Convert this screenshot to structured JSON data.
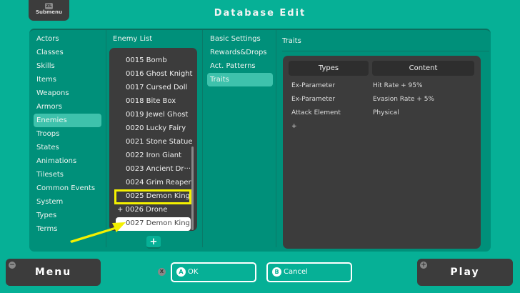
{
  "header": {
    "submenu_icon": "ZL",
    "submenu_label": "Submenu",
    "title": "Database Edit"
  },
  "categories": [
    "Actors",
    "Classes",
    "Skills",
    "Items",
    "Weapons",
    "Armors",
    "Enemies",
    "Troops",
    "States",
    "Animations",
    "Tilesets",
    "Common Events",
    "System",
    "Types",
    "Terms"
  ],
  "selected_category": "Enemies",
  "enemy_list": {
    "heading": "Enemy List",
    "items": [
      "0015 Bomb",
      "0016 Ghost Knight",
      "0017 Cursed Doll",
      "0018 Bite Box",
      "0019 Jewel Ghost",
      "0020 Lucky Fairy",
      "0021 Stone Statue",
      "0022 Iron Giant",
      "0023 Ancient Dr···",
      "0024 Grim Reaper",
      "0025 Demon King",
      "+ 0026 Drone",
      "0027 Demon King"
    ],
    "add_label": "+"
  },
  "tabs": [
    "Basic Settings",
    "Rewards&Drops",
    "Act. Patterns",
    "Traits"
  ],
  "active_tab": "Traits",
  "traits": {
    "heading": "Traits",
    "col_types": "Types",
    "col_content": "Content",
    "rows": [
      {
        "type": "Ex-Parameter",
        "content": "Hit Rate + 95%"
      },
      {
        "type": "Ex-Parameter",
        "content": "Evasion Rate + 5%"
      },
      {
        "type": "Attack Element",
        "content": "Physical"
      }
    ],
    "add_label": "+"
  },
  "footer": {
    "menu": "Menu",
    "menu_icon": "−",
    "x_icon": "X",
    "ok_icon": "A",
    "ok": "OK",
    "cancel_icon": "B",
    "cancel": "Cancel",
    "play": "Play",
    "play_icon": "+"
  },
  "colors": {
    "bg": "#06b096",
    "panel": "#00907a",
    "dark": "#3c3c3c",
    "highlight": "#f4f000"
  }
}
